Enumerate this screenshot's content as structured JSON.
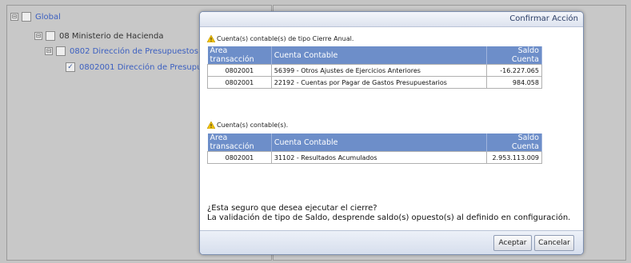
{
  "tree": {
    "nodes": [
      {
        "label": "Global",
        "expander": "⊟",
        "checked": ""
      },
      {
        "label": "08 Ministerio de Hacienda",
        "expander": "⊟",
        "checked": ""
      },
      {
        "label": "0802 Dirección de Presupuestos",
        "expander": "⊟",
        "checked": ""
      },
      {
        "label": "0802001 Dirección de Presupuestos",
        "checked": "✓"
      }
    ]
  },
  "dialog": {
    "title": "Confirmar Acción",
    "section1": {
      "label": "Cuenta(s) contable(s) de tipo Cierre Anual.",
      "columns": [
        "Área transacción",
        "Cuenta Contable",
        "Saldo Cuenta"
      ],
      "rows": [
        {
          "area": "0802001",
          "cuenta": "56399 - Otros Ajustes de Ejercicios Anteriores",
          "saldo": "-16.227.065"
        },
        {
          "area": "0802001",
          "cuenta": "22192 - Cuentas por Pagar de Gastos Presupuestarios",
          "saldo": "984.058"
        }
      ]
    },
    "section2": {
      "label": "Cuenta(s) contable(s).",
      "columns": [
        "Área transacción",
        "Cuenta Contable",
        "Saldo Cuenta"
      ],
      "rows": [
        {
          "area": "0802001",
          "cuenta": "31102 - Resultados Acumulados",
          "saldo": "2.953.113.009"
        }
      ]
    },
    "question_line1": "¿Esta seguro que desea ejecutar el cierre?",
    "question_line2": "La validación de tipo de Saldo, desprende saldo(s) opuesto(s) al definido en configuración.",
    "accept_label": "Aceptar",
    "cancel_label": "Cancelar"
  },
  "colors": {
    "header_blue": "#6d8ec9",
    "link_blue": "#3b5fc0",
    "warning_yellow": "#f2c200"
  }
}
